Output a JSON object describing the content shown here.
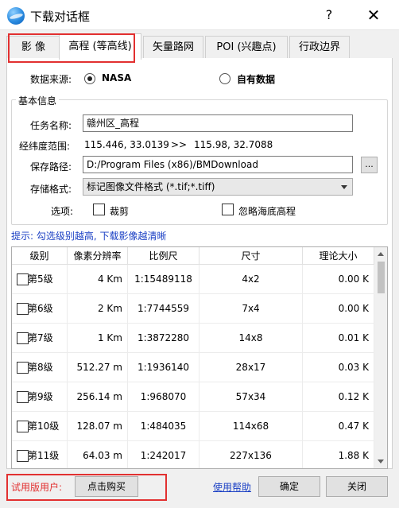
{
  "window": {
    "title": "下载对话框",
    "help_glyph": "?",
    "close_glyph": "✕"
  },
  "tabs": [
    {
      "label": "影 像"
    },
    {
      "label": "高程 (等高线)"
    },
    {
      "label": "矢量路网"
    },
    {
      "label": "POI (兴趣点)"
    },
    {
      "label": "行政边界"
    }
  ],
  "source": {
    "label": "数据来源:",
    "option1": "NASA",
    "option2": "自有数据",
    "selected": "NASA"
  },
  "basic_info": {
    "group_title": "基本信息",
    "task_name_label": "任务名称:",
    "task_name_value": "赣州区_高程",
    "range_label": "经纬度范围:",
    "range_from": "115.446, 33.0139",
    "range_arrow": ">>",
    "range_to": "115.98, 32.7088",
    "save_path_label": "保存路径:",
    "save_path_value": "D:/Program Files (x86)/BMDownload",
    "browse_label": "...",
    "format_label": "存储格式:",
    "format_value": "标记图像文件格式 (*.tif;*.tiff)",
    "options_label": "选项:",
    "crop_label": "裁剪",
    "ignore_label": "忽略海底高程"
  },
  "hint": "提示: 勾选级别越高, 下载影像越清晰",
  "table": {
    "headers": [
      "级别",
      "像素分辨率",
      "比例尺",
      "尺寸",
      "理论大小"
    ],
    "rows": [
      {
        "level": "第5级",
        "res": "4 Km",
        "scale": "1:15489118",
        "size": "4x2",
        "theory": "0.00 K"
      },
      {
        "level": "第6级",
        "res": "2 Km",
        "scale": "1:7744559",
        "size": "7x4",
        "theory": "0.00 K"
      },
      {
        "level": "第7级",
        "res": "1 Km",
        "scale": "1:3872280",
        "size": "14x8",
        "theory": "0.01 K"
      },
      {
        "level": "第8级",
        "res": "512.27  m",
        "scale": "1:1936140",
        "size": "28x17",
        "theory": "0.03 K"
      },
      {
        "level": "第9级",
        "res": "256.14  m",
        "scale": "1:968070",
        "size": "57x34",
        "theory": "0.12 K"
      },
      {
        "level": "第10级",
        "res": "128.07  m",
        "scale": "1:484035",
        "size": "114x68",
        "theory": "0.47 K"
      },
      {
        "level": "第11级",
        "res": "64.03  m",
        "scale": "1:242017",
        "size": "227x136",
        "theory": "1.88 K"
      }
    ]
  },
  "footer": {
    "trial_label": "试用版用户:",
    "buy_label": "点击购买",
    "help_link": "使用帮助",
    "ok_label": "确定",
    "close_label": "关闭"
  },
  "colors": {
    "highlight_red": "#e23030",
    "hint_blue": "#1a3fc4"
  }
}
